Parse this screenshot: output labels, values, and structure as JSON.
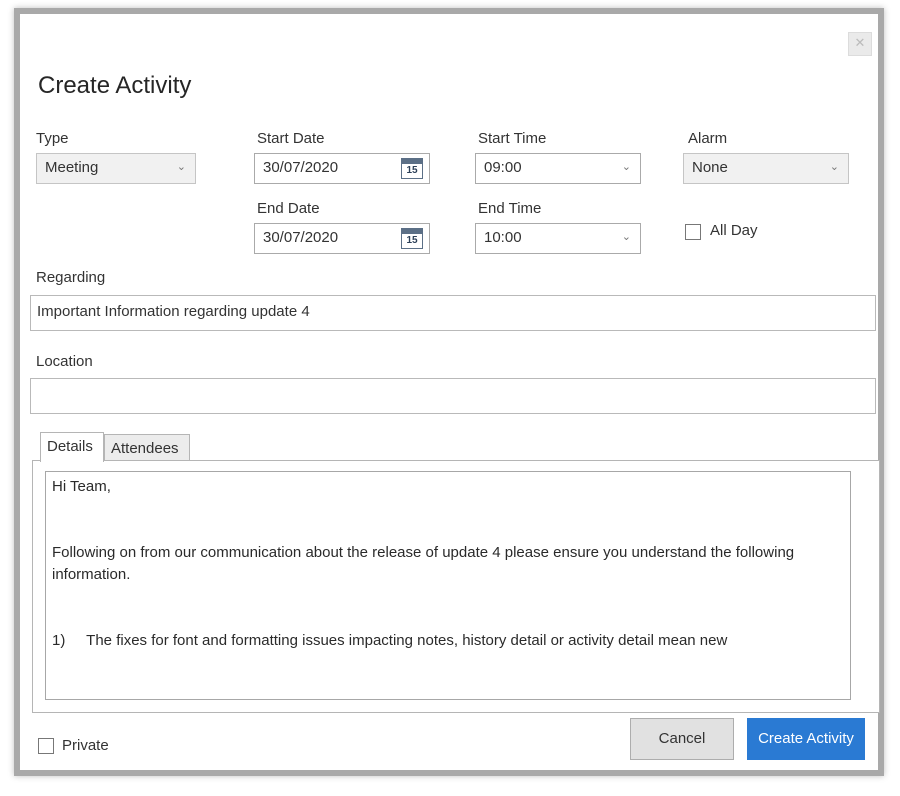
{
  "dialog": {
    "title": "Create Activity",
    "close_glyph": "✕"
  },
  "fields": {
    "type": {
      "label": "Type",
      "value": "Meeting"
    },
    "start_date": {
      "label": "Start Date",
      "value": "30/07/2020"
    },
    "end_date": {
      "label": "End Date",
      "value": "30/07/2020"
    },
    "start_time": {
      "label": "Start Time",
      "value": "09:00"
    },
    "end_time": {
      "label": "End Time",
      "value": "10:00"
    },
    "alarm": {
      "label": "Alarm",
      "value": "None"
    },
    "all_day": {
      "label": "All Day",
      "checked": false
    },
    "regarding": {
      "label": "Regarding",
      "value": "Important Information regarding update 4"
    },
    "location": {
      "label": "Location",
      "value": ""
    },
    "calendar_icon_day": "15"
  },
  "tabs": [
    {
      "label": "Details",
      "active": true
    },
    {
      "label": "Attendees",
      "active": false
    }
  ],
  "details": {
    "lines": [
      "Hi Team,",
      "",
      "",
      "Following on from our communication about the release of update 4 please ensure you understand the following information.",
      "",
      "",
      "1)     The fixes for font and formatting issues impacting notes, history detail or activity detail mean new"
    ]
  },
  "footer": {
    "private_label": "Private",
    "private_checked": false,
    "cancel_label": "Cancel",
    "create_label": "Create Activity"
  },
  "colors": {
    "primary_button": "#2a7ad3",
    "dialog_border": "#a9a9a9"
  }
}
